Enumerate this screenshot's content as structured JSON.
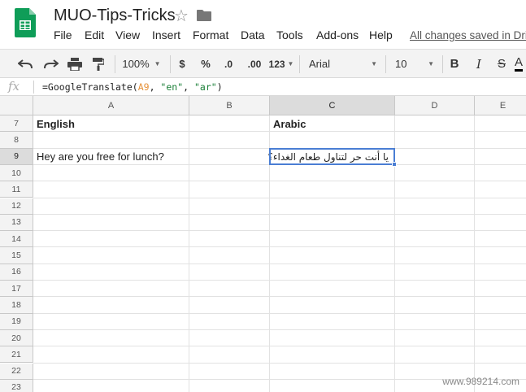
{
  "app": {
    "doc_title": "MUO-Tips-Tricks",
    "star_icon": "star-icon",
    "folder_icon": "folder-icon",
    "saved_status": "All changes saved in Dri",
    "brand_color": "#0f9d58"
  },
  "menu": [
    "File",
    "Edit",
    "View",
    "Insert",
    "Format",
    "Data",
    "Tools",
    "Add-ons",
    "Help"
  ],
  "toolbar": {
    "zoom": "100%",
    "currency": "$",
    "percent": "%",
    "decrease_decimal": ".0",
    "increase_decimal": ".00",
    "more_formats": "123",
    "font": "Arial",
    "font_size": "10",
    "bold": "B",
    "italic": "I",
    "strike": "S",
    "text_color": "A"
  },
  "formula_bar": {
    "fx_label": "fx",
    "formula_prefix": "=GoogleTranslate(",
    "formula_ref": "A9",
    "formula_mid1": ", ",
    "formula_arg1": "\"en\"",
    "formula_mid2": ", ",
    "formula_arg2": "\"ar\"",
    "formula_suffix": ")"
  },
  "sheet": {
    "columns": [
      "A",
      "B",
      "C",
      "D",
      "E"
    ],
    "selected_column": "C",
    "rows": [
      "7",
      "8",
      "9",
      "10",
      "11",
      "12",
      "13",
      "14",
      "15",
      "16",
      "17",
      "18",
      "19",
      "20",
      "21",
      "22",
      "23"
    ],
    "selected_row": "9",
    "cells": {
      "A7": "English",
      "C7": "Arabic",
      "A9": "Hey are you free for lunch?",
      "C9": "يا أنت حر لتناول طعام الغداء؟"
    },
    "active_cell": "C9",
    "active_color": "#4a7ed4"
  },
  "watermark": "www.989214.com"
}
